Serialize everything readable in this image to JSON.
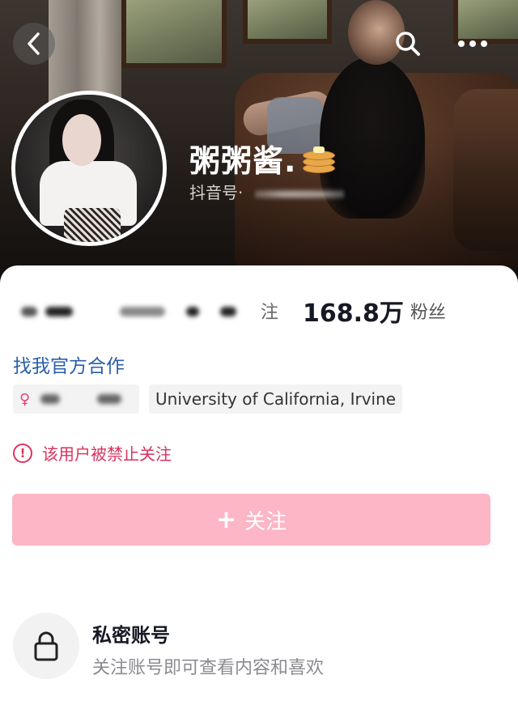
{
  "header": {
    "back_icon": "chevron-left-icon",
    "search_icon": "search-icon",
    "more_icon": "more-horizontal-icon"
  },
  "profile": {
    "name": "粥粥酱.",
    "name_emoji": "pancake",
    "douyin_id_label": "抖音号·"
  },
  "stats": {
    "following_label_tail": "注",
    "followers_count": "168.8万",
    "followers_label": "粉丝"
  },
  "cooperation_link": "找我官方合作",
  "tags": {
    "school": "University of California, Irvine"
  },
  "warning": {
    "text": "该用户被禁止关注",
    "color": "#e0325f"
  },
  "follow_button": {
    "label": "关注",
    "plus": "+",
    "color": "#fcb6c6"
  },
  "private_account": {
    "title": "私密账号",
    "description": "关注账号即可查看内容和喜欢",
    "icon": "lock-icon"
  }
}
